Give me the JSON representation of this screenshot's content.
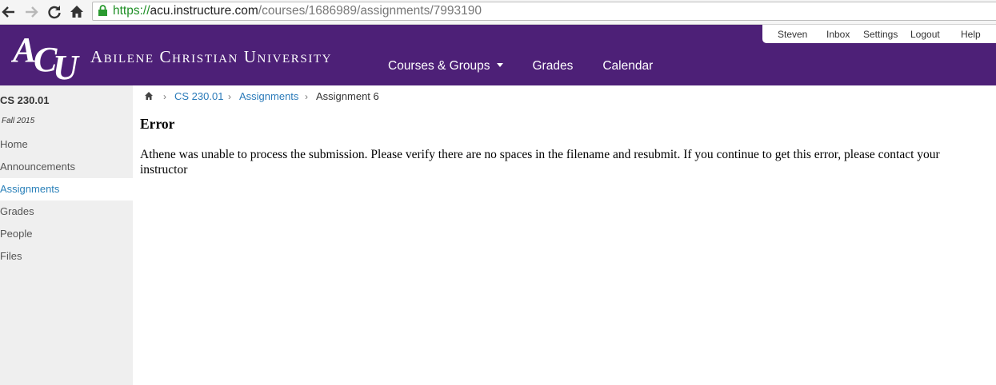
{
  "browser": {
    "url_scheme": "https://",
    "url_host": "acu.instructure.com",
    "url_path": "/courses/1686989/assignments/7993190"
  },
  "header": {
    "school_name": "Abilene Christian University",
    "nav": [
      "Courses & Groups",
      "Grades",
      "Calendar"
    ],
    "user_links": [
      "Steven",
      "Inbox",
      "Settings",
      "Logout",
      "Help"
    ],
    "brand_color": "#4d2077"
  },
  "sidebar": {
    "course_code": "CS 230.01",
    "term": "Fall 2015",
    "items": [
      {
        "label": "Home",
        "active": false
      },
      {
        "label": "Announcements",
        "active": false
      },
      {
        "label": "Assignments",
        "active": true
      },
      {
        "label": "Grades",
        "active": false
      },
      {
        "label": "People",
        "active": false
      },
      {
        "label": "Files",
        "active": false
      }
    ]
  },
  "breadcrumb": {
    "course": "CS 230.01",
    "section": "Assignments",
    "current": "Assignment 6"
  },
  "error": {
    "title": "Error",
    "message": "Athene was unable to process the submission. Please verify there are no spaces in the filename and resubmit. If you continue to get this error, please contact your instructor"
  }
}
